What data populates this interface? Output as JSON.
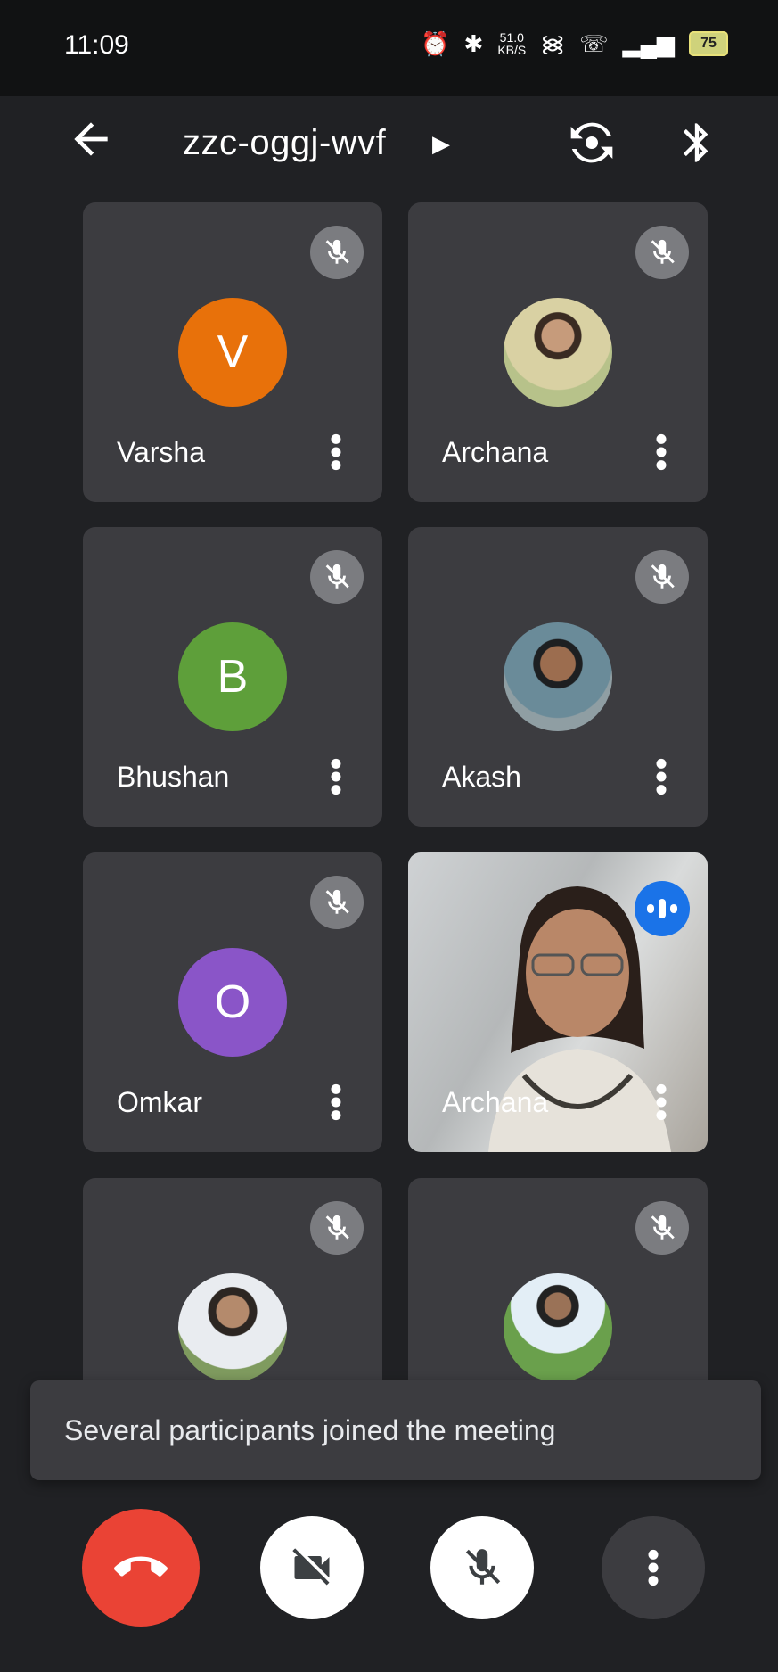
{
  "status_bar": {
    "time": "11:09",
    "net_speed": "51.0",
    "net_unit": "KB/S",
    "battery": "75"
  },
  "header": {
    "meeting_code": "zzc-oggj-wvf"
  },
  "participants": [
    {
      "name": "Varsha",
      "initial": "V",
      "color": "#e8710a"
    },
    {
      "name": "Archana",
      "initial": "",
      "color": ""
    },
    {
      "name": "Bhushan",
      "initial": "B",
      "color": "#5e9f3a"
    },
    {
      "name": "Akash",
      "initial": "",
      "color": ""
    },
    {
      "name": "Omkar",
      "initial": "O",
      "color": "#8a55c8"
    },
    {
      "name": "Archana",
      "initial": "",
      "color": ""
    }
  ],
  "toast": {
    "message": "Several participants joined the meeting"
  },
  "colors": {
    "end_call": "#ea4335",
    "speaking_indicator": "#1a73e8",
    "background": "#202124",
    "tile": "#3c3c40"
  }
}
